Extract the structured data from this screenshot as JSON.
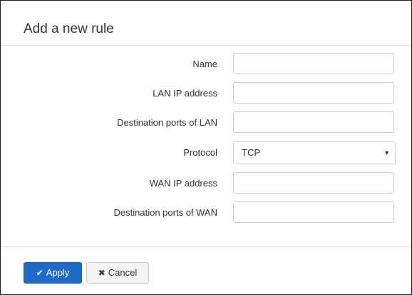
{
  "dialog": {
    "title": "Add a new rule"
  },
  "form": {
    "fields": [
      {
        "label": "Name",
        "value": ""
      },
      {
        "label": "LAN IP address",
        "value": ""
      },
      {
        "label": "Destination ports of LAN",
        "value": ""
      },
      {
        "label": "Protocol",
        "selected": "TCP"
      },
      {
        "label": "WAN IP address",
        "value": ""
      },
      {
        "label": "Destination ports of WAN",
        "value": ""
      }
    ]
  },
  "footer": {
    "apply_label": "Apply",
    "apply_icon": "check-icon",
    "cancel_label": "Cancel",
    "cancel_icon": "x-icon"
  },
  "colors": {
    "primary": "#1f6bc9",
    "border": "#cccccc"
  }
}
